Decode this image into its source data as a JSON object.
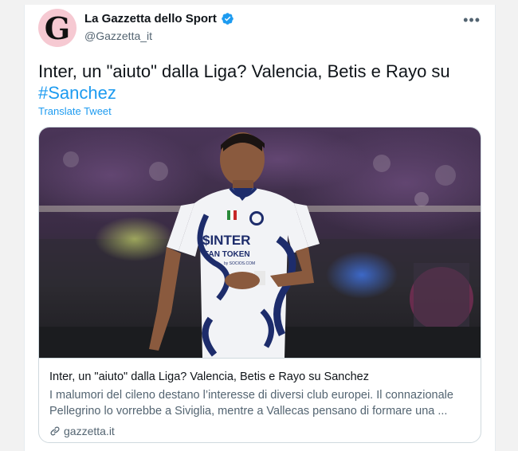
{
  "tweet": {
    "author_name": "La Gazzetta dello Sport",
    "author_handle": "@Gazzetta_it",
    "avatar_letter": "G",
    "text_main": "Inter, un \"aiuto\" dalla Liga? Valencia, Betis e Rayo su",
    "hashtag": "#Sanchez",
    "translate_label": "Translate Tweet",
    "more_label": "•••"
  },
  "card": {
    "title": "Inter, un \"aiuto\" dalla Liga? Valencia, Betis e Rayo su Sanchez",
    "description": "I malumori del cileno destano l’interesse di diversi club europei. Il connazionale Pellegrino lo vorrebbe a Siviglia, mentre a Vallecas pensano di formare una ...",
    "domain": "gazzetta.it",
    "jersey_sponsor": "$INTER",
    "jersey_sponsor_sub": "FAN TOKEN",
    "jersey_small": "by SOCIOS.COM"
  },
  "icons": {
    "verified": "verified-badge-icon",
    "more": "more-options-icon",
    "link": "link-icon"
  },
  "colors": {
    "accent": "#1d9bf0",
    "avatar_bg": "#f6c9d2",
    "secondary_text": "#536471"
  }
}
